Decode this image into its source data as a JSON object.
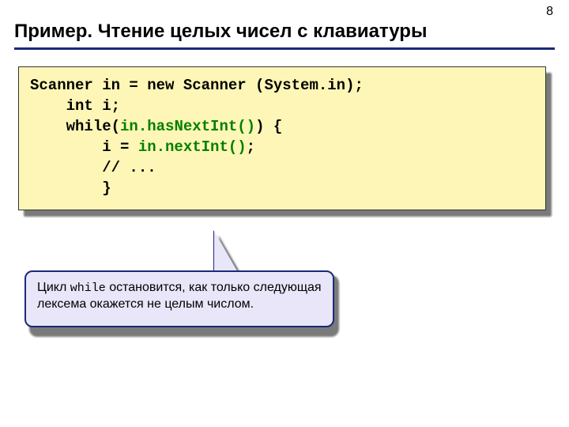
{
  "page_number": "8",
  "title": "Пример. Чтение целых чисел с клавиатуры",
  "code_block": {
    "lines": [
      {
        "segments": [
          {
            "t": "Scanner in = new Scanner (System.in);",
            "cls": "kw"
          }
        ]
      },
      {
        "segments": [
          {
            "t": "    int i;",
            "cls": "kw"
          }
        ]
      },
      {
        "segments": [
          {
            "t": "    while(",
            "cls": "kw"
          },
          {
            "t": "in.hasNextInt()",
            "cls": "call"
          },
          {
            "t": ") {",
            "cls": "kw"
          }
        ]
      },
      {
        "segments": [
          {
            "t": "        i = ",
            "cls": "kw"
          },
          {
            "t": "in.nextInt()",
            "cls": "call"
          },
          {
            "t": ";",
            "cls": "kw"
          }
        ]
      },
      {
        "segments": [
          {
            "t": "        // ...",
            "cls": "kw"
          }
        ]
      },
      {
        "segments": [
          {
            "t": "        }",
            "cls": "kw"
          }
        ]
      }
    ]
  },
  "callout": {
    "pre": "Цикл ",
    "mono": "while",
    "post": " остановится, как только следующая лексема окажется не целым числом."
  }
}
